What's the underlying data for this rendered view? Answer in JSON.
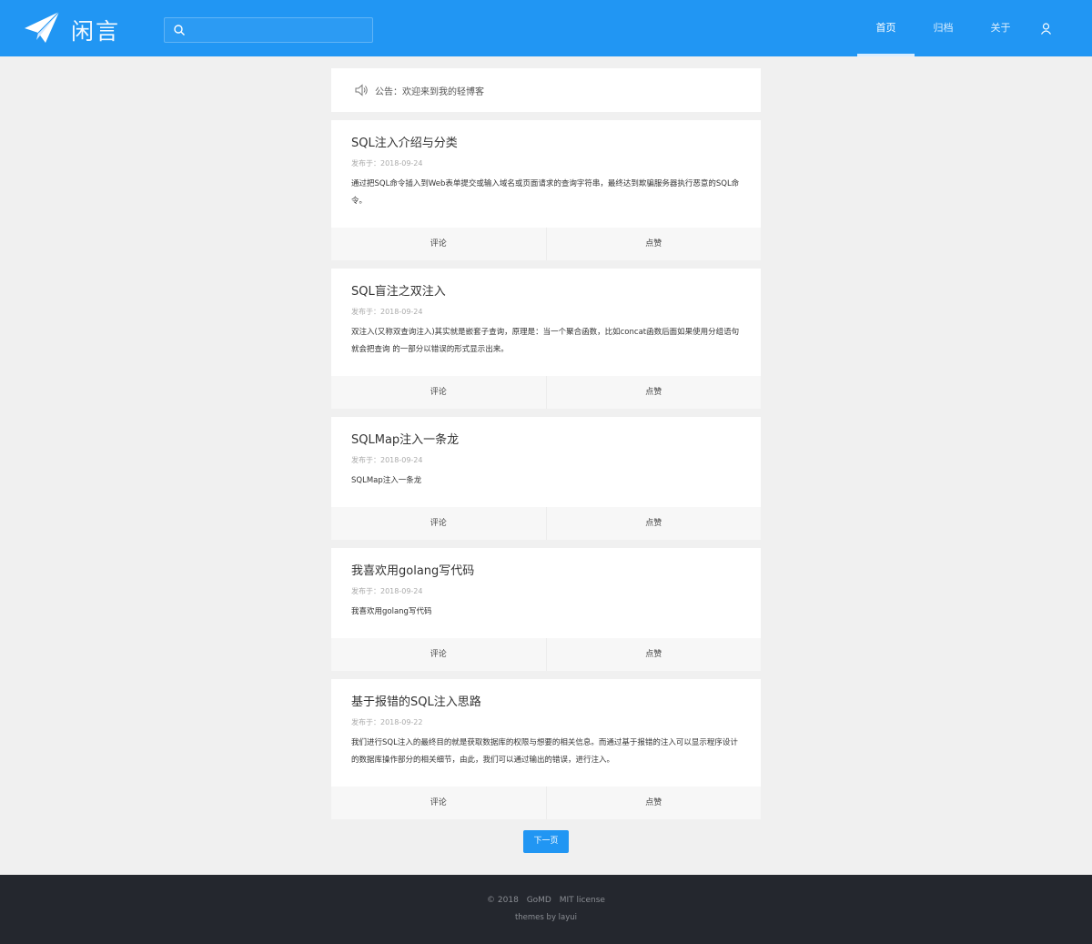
{
  "header": {
    "logo_text": "闲言",
    "search": {
      "value": "",
      "placeholder": ""
    },
    "nav": [
      "首页",
      "归档",
      "关于"
    ],
    "active_nav": "首页",
    "accent_color": "#2196f3"
  },
  "notice": {
    "text": "公告：欢迎来到我的轻博客"
  },
  "posts": [
    {
      "title": "SQL注入介绍与分类",
      "date": "发布于：2018-09-24",
      "summary": "通过把SQL命令插入到Web表单提交或输入域名或页面请求的查询字符串，最终达到欺骗服务器执行恶意的SQL命令。",
      "comment_label": "评论",
      "like_label": "点赞"
    },
    {
      "title": "SQL盲注之双注入",
      "date": "发布于：2018-09-24",
      "summary": "双注入(又称双查询注入)其实就是嵌套子查询，原理是：当一个聚合函数，比如concat函数后面如果使用分组语句就会把查询 的一部分以错误的形式显示出来。",
      "comment_label": "评论",
      "like_label": "点赞"
    },
    {
      "title": "SQLMap注入一条龙",
      "date": "发布于：2018-09-24",
      "summary": "SQLMap注入一条龙",
      "comment_label": "评论",
      "like_label": "点赞"
    },
    {
      "title": "我喜欢用golang写代码",
      "date": "发布于：2018-09-24",
      "summary": "我喜欢用golang写代码",
      "comment_label": "评论",
      "like_label": "点赞"
    },
    {
      "title": "基于报错的SQL注入思路",
      "date": "发布于：2018-09-22",
      "summary": "我们进行SQL注入的最终目的就是获取数据库的权限与想要的相关信息。而通过基于报错的注入可以显示程序设计的数据库操作部分的相关细节，由此，我们可以通过输出的错误，进行注入。",
      "comment_label": "评论",
      "like_label": "点赞"
    }
  ],
  "pagination": {
    "next_label": "下一页"
  },
  "footer": {
    "copyright": "© 2018",
    "site_link": "GoMD",
    "license_link": "MIT license",
    "theme_credit": "themes by layui"
  }
}
